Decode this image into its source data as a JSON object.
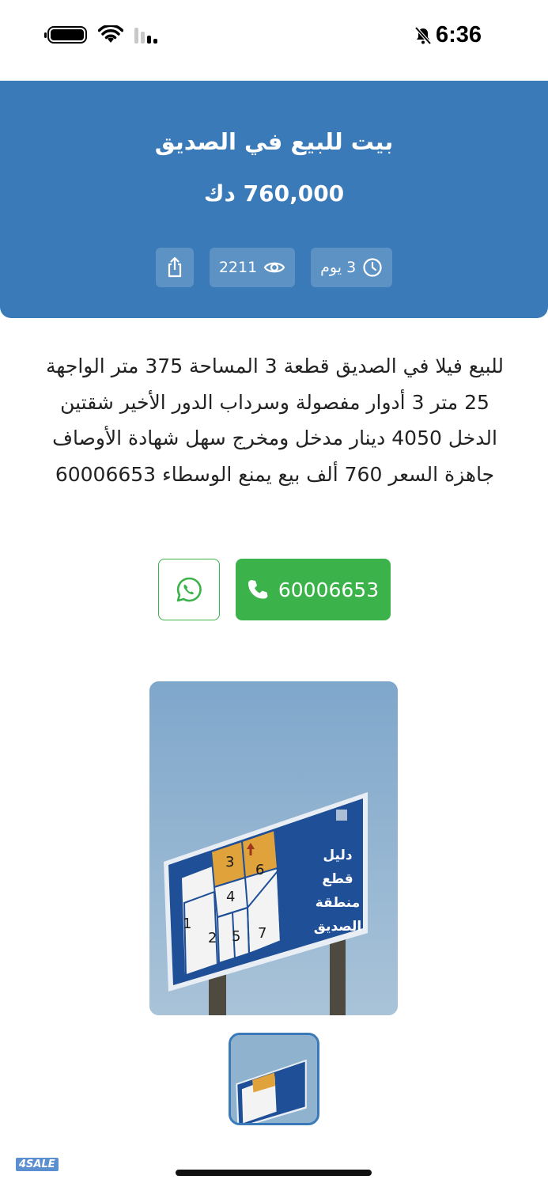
{
  "status_bar": {
    "time": "6:36"
  },
  "listing": {
    "title": "بيت للبيع في الصديق",
    "price": "760,000 دك",
    "age": "3 يوم",
    "views": "2211",
    "description": "للبيع فيلا في الصديق قطعة 3 المساحة 375 متر الواجهة 25 متر 3 أدوار مفصولة وسرداب الدور الأخير شقتين الدخل 4050 دينار مدخل ومخرج سهل شهادة الأوصاف جاهزة السعر 760 ألف بيع يمنع الوسطاء 60006653"
  },
  "contact": {
    "phone": "60006653"
  },
  "sign": {
    "lines": [
      "دليل",
      "قطع",
      "منطقة",
      "الصديق"
    ],
    "blocks": [
      "3",
      "6",
      "4",
      "1",
      "2",
      "5",
      "7"
    ]
  },
  "watermark": "4SALE",
  "colors": {
    "header": "#3a7ab8",
    "call": "#3bb24a",
    "whatsapp": "#3bb24a"
  }
}
